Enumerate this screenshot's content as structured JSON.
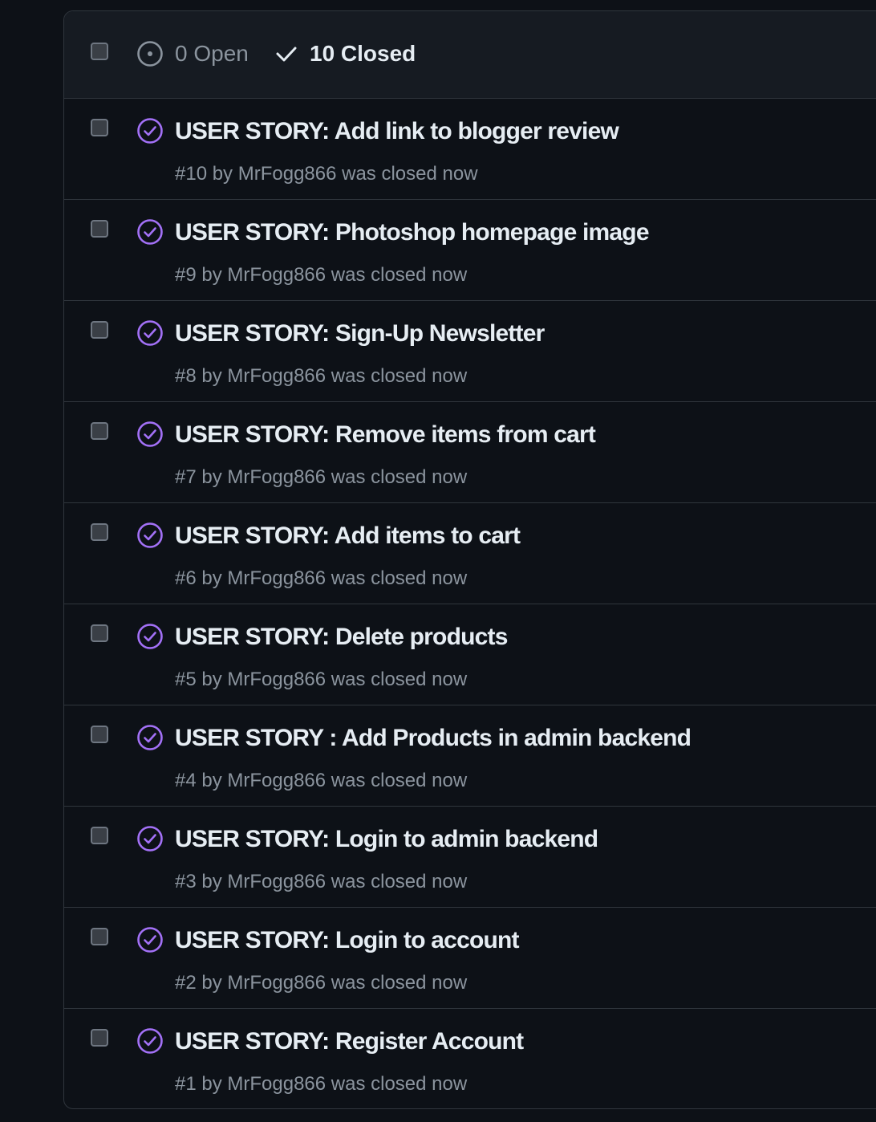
{
  "header": {
    "open_label": "0 Open",
    "closed_label": "10 Closed"
  },
  "colors": {
    "background": "#0d1117",
    "header_bg": "#161b22",
    "border": "#30363d",
    "closed_purple": "#a371f7",
    "title_text": "#e6edf3",
    "muted_text": "#8b949e"
  },
  "issues": [
    {
      "title": "USER STORY: Add link to blogger review",
      "meta": "#10 by MrFogg866 was closed now",
      "icon": "issue-closed-icon"
    },
    {
      "title": "USER STORY: Photoshop homepage image",
      "meta": "#9 by MrFogg866 was closed now",
      "icon": "issue-closed-icon"
    },
    {
      "title": "USER STORY: Sign-Up Newsletter",
      "meta": "#8 by MrFogg866 was closed now",
      "icon": "issue-closed-icon"
    },
    {
      "title": "USER STORY: Remove items from cart",
      "meta": "#7 by MrFogg866 was closed now",
      "icon": "issue-closed-icon"
    },
    {
      "title": "USER STORY: Add items to cart",
      "meta": "#6 by MrFogg866 was closed now",
      "icon": "issue-closed-icon"
    },
    {
      "title": "USER STORY: Delete products",
      "meta": "#5 by MrFogg866 was closed now",
      "icon": "issue-closed-icon"
    },
    {
      "title": "USER STORY : Add Products in admin backend",
      "meta": "#4 by MrFogg866 was closed now",
      "icon": "issue-closed-icon"
    },
    {
      "title": "USER STORY: Login to admin backend",
      "meta": "#3 by MrFogg866 was closed now",
      "icon": "issue-closed-icon"
    },
    {
      "title": "USER STORY: Login to account",
      "meta": "#2 by MrFogg866 was closed now",
      "icon": "issue-closed-icon"
    },
    {
      "title": "USER STORY: Register Account",
      "meta": "#1 by MrFogg866 was closed now",
      "icon": "issue-closed-icon"
    }
  ]
}
